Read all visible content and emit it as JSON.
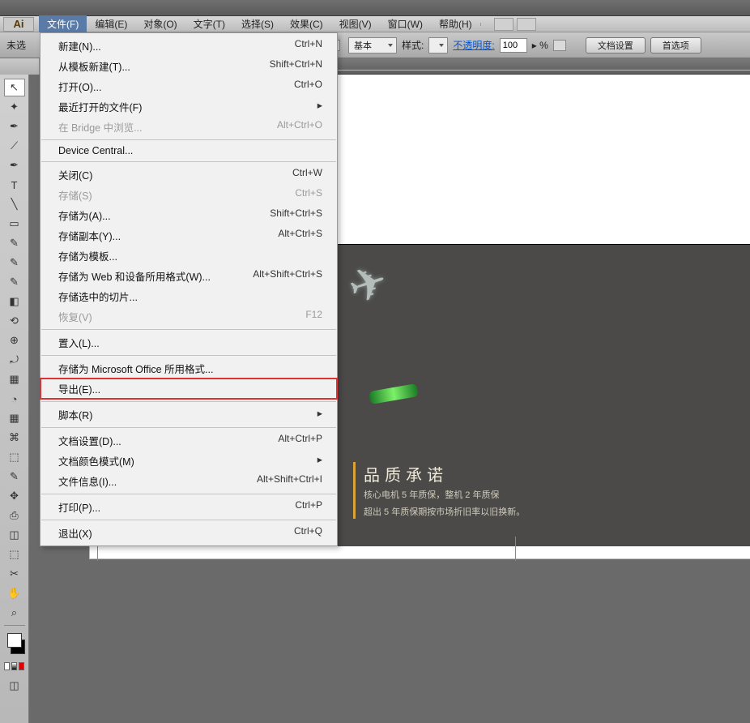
{
  "menu": {
    "logo": "Ai",
    "items": [
      "文件(F)",
      "编辑(E)",
      "对象(O)",
      "文字(T)",
      "选择(S)",
      "效果(C)",
      "视图(V)",
      "窗口(W)",
      "帮助(H)"
    ]
  },
  "control": {
    "doc_truncated": "未选",
    "basic": "基本",
    "style_label": "样式:",
    "opacity_label": "不透明度:",
    "opacity_value": "100",
    "opacity_unit": "%",
    "doc_setup": "文档设置",
    "prefs": "首选项"
  },
  "dropdown": [
    {
      "label": "新建(N)...",
      "shortcut": "Ctrl+N"
    },
    {
      "label": "从模板新建(T)...",
      "shortcut": "Shift+Ctrl+N"
    },
    {
      "label": "打开(O)...",
      "shortcut": "Ctrl+O"
    },
    {
      "label": "最近打开的文件(F)",
      "sub": true
    },
    {
      "label": "在 Bridge 中浏览...",
      "shortcut": "Alt+Ctrl+O",
      "disabled": true
    },
    {
      "sep": true
    },
    {
      "label": "Device Central..."
    },
    {
      "sep": true
    },
    {
      "label": "关闭(C)",
      "shortcut": "Ctrl+W"
    },
    {
      "label": "存储(S)",
      "shortcut": "Ctrl+S",
      "disabled": true
    },
    {
      "label": "存储为(A)...",
      "shortcut": "Shift+Ctrl+S"
    },
    {
      "label": "存储副本(Y)...",
      "shortcut": "Alt+Ctrl+S"
    },
    {
      "label": "存储为模板..."
    },
    {
      "label": "存储为 Web 和设备所用格式(W)...",
      "shortcut": "Alt+Shift+Ctrl+S"
    },
    {
      "label": "存储选中的切片..."
    },
    {
      "label": "恢复(V)",
      "shortcut": "F12",
      "disabled": true
    },
    {
      "sep": true
    },
    {
      "label": "置入(L)..."
    },
    {
      "sep": true
    },
    {
      "label": "存储为 Microsoft Office 所用格式..."
    },
    {
      "label": "导出(E)...",
      "highlight": true
    },
    {
      "sep": true
    },
    {
      "label": "脚本(R)",
      "sub": true
    },
    {
      "sep": true
    },
    {
      "label": "文档设置(D)...",
      "shortcut": "Alt+Ctrl+P"
    },
    {
      "label": "文档颜色模式(M)",
      "sub": true
    },
    {
      "label": "文件信息(I)...",
      "shortcut": "Alt+Shift+Ctrl+I"
    },
    {
      "sep": true
    },
    {
      "label": "打印(P)...",
      "shortcut": "Ctrl+P"
    },
    {
      "sep": true
    },
    {
      "label": "退出(X)",
      "shortcut": "Ctrl+Q"
    }
  ],
  "artwork": {
    "headline": "品质承诺",
    "line1": "核心电机 5 年质保，整机 2 年质保",
    "line2": "超出 5 年质保期按市场折旧率以旧换新。"
  },
  "tools": [
    "⬚",
    "↖",
    "✦",
    "✒",
    "⟋",
    "▭",
    "T",
    "╲",
    "◠",
    "✎",
    "⟲",
    "◧",
    "⤾",
    "▦",
    "⊕",
    "◔",
    "⌘",
    "⬚",
    "✋",
    "⊡",
    "✥",
    "⎙",
    "⌄",
    "✂",
    "↔",
    "⤢",
    "◫",
    "✋",
    "⌕",
    "▭"
  ]
}
